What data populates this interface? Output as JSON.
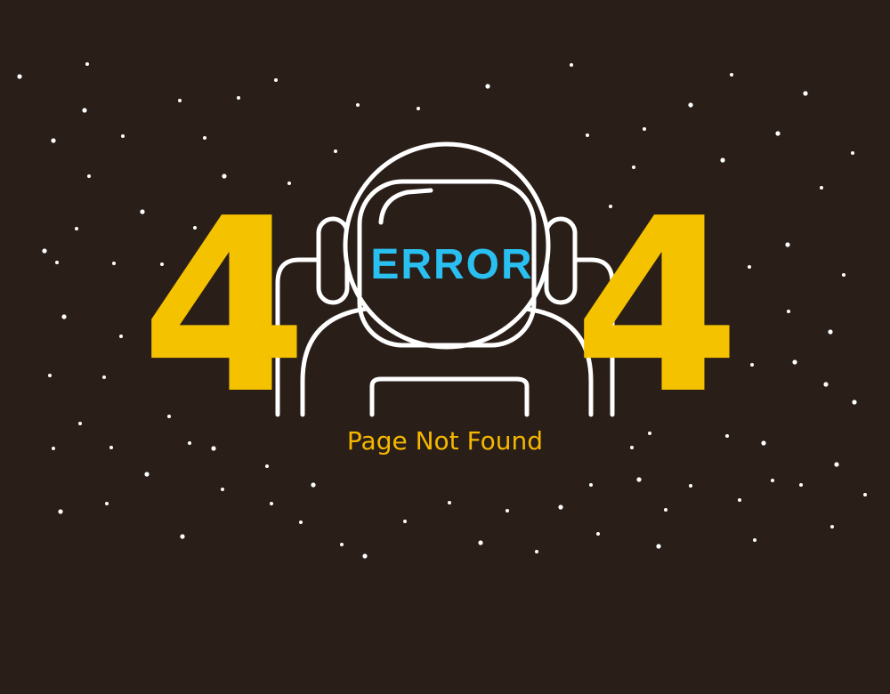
{
  "illustration": {
    "left_digit": "4",
    "right_digit": "4",
    "visor_text": "ERROR",
    "caption": "Page Not Found"
  },
  "colors": {
    "background": "#2a1e18",
    "digits": "#f5c200",
    "visor_text": "#29bff0",
    "caption": "#f5b800",
    "outline": "#ffffff",
    "stars": "#ffffff"
  },
  "icons": {
    "figure": "astronaut-helmet-icon",
    "background_pattern": "starfield"
  }
}
